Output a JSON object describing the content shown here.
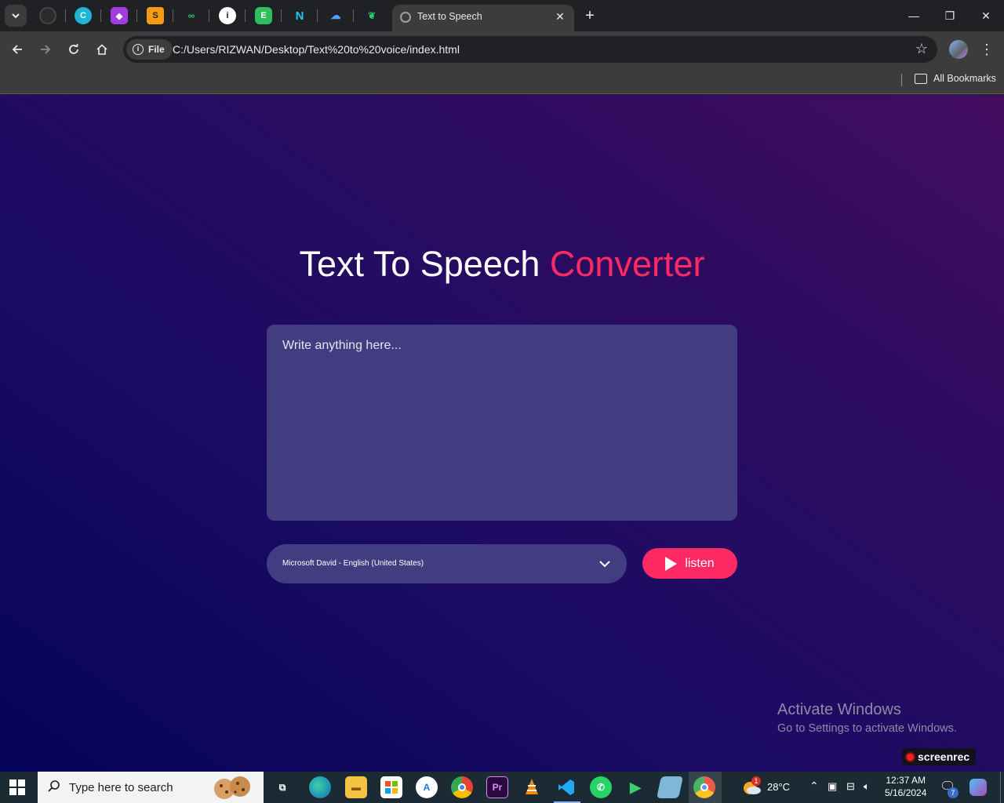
{
  "browser": {
    "active_tab": {
      "title": "Text to Speech"
    },
    "address": {
      "chip_label": "File",
      "url": "C:/Users/RIZWAN/Desktop/Text%20to%20voice/index.html"
    },
    "bookmarks": {
      "all_bookmarks": "All Bookmarks"
    },
    "pinned_tab_icons": [
      "github-icon",
      "canva-icon",
      "craft-icon",
      "sublime-icon",
      "connect-icon",
      "info-icon",
      "evernote-icon",
      "notion-icon",
      "cloud-icon",
      "leaf-icon"
    ]
  },
  "page": {
    "heading_main": "Text To Speech",
    "heading_accent": "Converter",
    "textarea_placeholder": "Write anything here...",
    "voice_select_value": "Microsoft David - English (United States)",
    "listen_label": "listen",
    "colors": {
      "accent": "#ff2963",
      "panel": "#423d80",
      "bg_start": "#06035a",
      "bg_end": "#440d60"
    }
  },
  "overlay": {
    "activate_title": "Activate Windows",
    "activate_sub": "Go to Settings to activate Windows.",
    "screenrec_label": "screenrec"
  },
  "taskbar": {
    "search_placeholder": "Type here to search",
    "apps": [
      "task-view-icon",
      "edge-icon",
      "file-explorer-icon",
      "store-icon",
      "app-icon",
      "chrome-icon",
      "premiere-icon",
      "vlc-icon",
      "vscode-icon",
      "whatsapp-icon",
      "media-player-icon",
      "notepad-icon",
      "chrome-profile-icon"
    ],
    "weather": "28°C",
    "weather_badge": "1",
    "time": "12:37 AM",
    "date": "5/16/2024",
    "notification_count": "7"
  }
}
